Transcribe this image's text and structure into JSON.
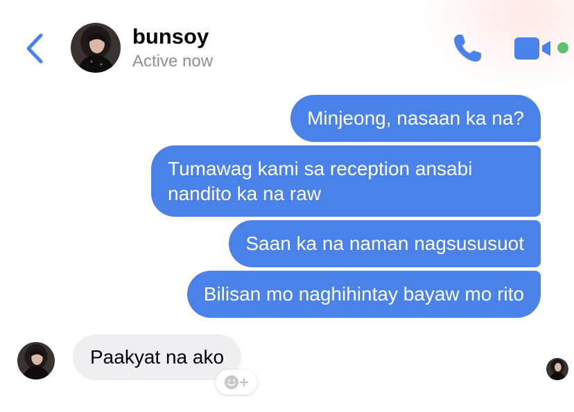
{
  "header": {
    "name": "bunsoy",
    "status": "Active now",
    "online": true
  },
  "messages": [
    {
      "direction": "outgoing",
      "text": "Minjeong, nasaan ka na?"
    },
    {
      "direction": "outgoing",
      "text": "Tumawag kami sa reception ansabi nandito ka na raw"
    },
    {
      "direction": "outgoing",
      "text": "Saan ka na naman nagsususuot"
    },
    {
      "direction": "outgoing",
      "text": "Bilisan mo naghihintay bayaw mo rito"
    },
    {
      "direction": "incoming",
      "text": "Paakyat na ako"
    }
  ],
  "icons": {
    "back": "chevron-left-icon",
    "call": "phone-icon",
    "video": "video-camera-icon",
    "reaction": "smiley-plus-icon"
  },
  "colors": {
    "accent": "#4a82ea",
    "outgoing_bubble": "#4a82ea",
    "incoming_bubble": "#efeff1",
    "online_indicator": "#5ec26a",
    "status_text": "#8e8e93"
  }
}
